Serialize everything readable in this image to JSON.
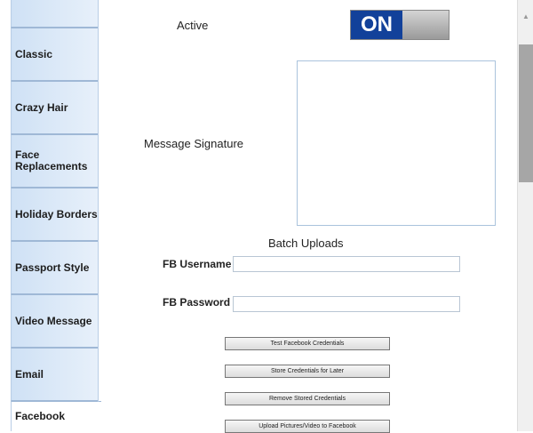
{
  "sidebar": {
    "items": [
      {
        "label": "Classic"
      },
      {
        "label": "Crazy Hair"
      },
      {
        "label": "Face Replacements"
      },
      {
        "label": "Holiday Borders"
      },
      {
        "label": "Passport Style"
      },
      {
        "label": "Video Message"
      },
      {
        "label": "Email"
      },
      {
        "label": "Facebook",
        "active": true
      }
    ]
  },
  "form": {
    "active_label": "Active",
    "toggle_state": "ON",
    "message_signature_label": "Message Signature",
    "batch_uploads_label": "Batch Uploads",
    "fb_username_label": "FB Username",
    "fb_username_value": "",
    "fb_password_label": "FB Password",
    "fb_password_value": ""
  },
  "buttons": {
    "test_credentials": "Test Facebook Credentials",
    "store_credentials": "Store Credentials for Later",
    "remove_credentials": "Remove Stored Credentials",
    "upload": "Upload Pictures/Video to Facebook"
  },
  "colors": {
    "toggle_on": "#12419a",
    "tab_background": "#cfe1f5"
  }
}
